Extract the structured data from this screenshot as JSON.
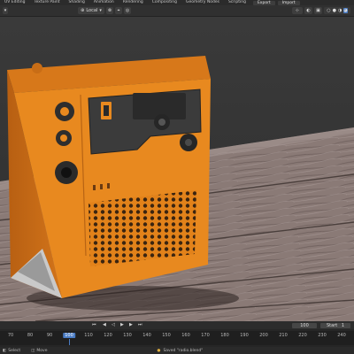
{
  "topbar": {
    "tabs": [
      "UV Editing",
      "Texture Paint",
      "Shading",
      "Animation",
      "Rendering",
      "Compositing",
      "Geometry Nodes",
      "Scripting"
    ],
    "buttons": [
      "Export",
      "Import"
    ]
  },
  "header": {
    "orientation": "Local"
  },
  "timeline": {
    "current_frame": "100",
    "start_label": "Start",
    "start_value": "1",
    "frame_field": "100",
    "ticks": [
      "70",
      "80",
      "90",
      "100",
      "110",
      "120",
      "130",
      "140",
      "150",
      "160",
      "170",
      "180",
      "190",
      "200",
      "210",
      "220",
      "230",
      "240"
    ]
  },
  "status": {
    "select_label": "Select",
    "move_label": "Move",
    "message": "Saved \"radio.blend\""
  },
  "colors": {
    "accent": "#4a7cc4",
    "radio_orange": "#e8891f",
    "wood": "#8c7b76"
  }
}
